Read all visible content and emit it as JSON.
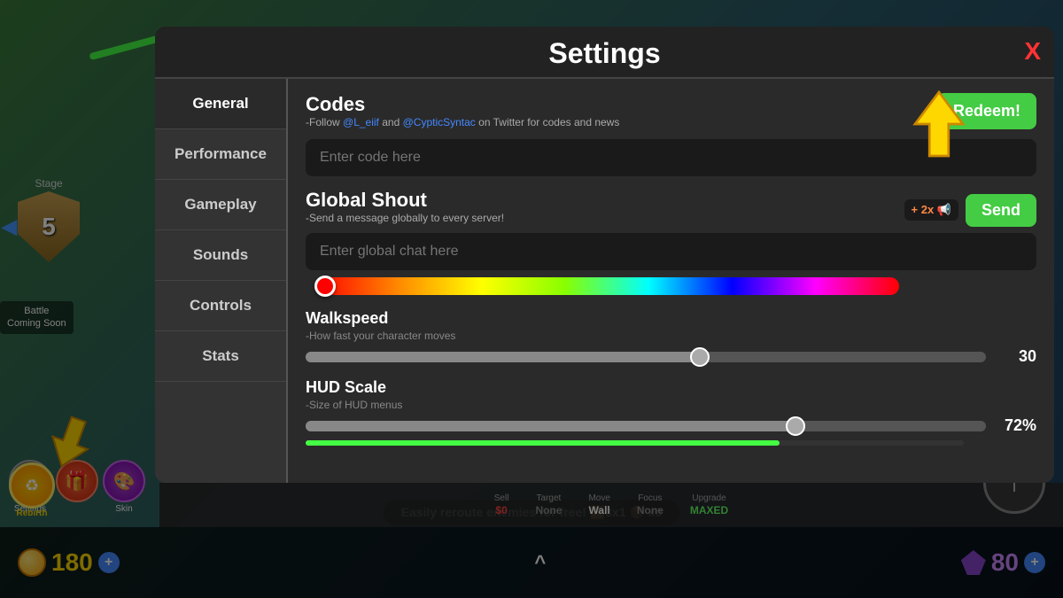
{
  "game": {
    "stage_label": "Stage",
    "stage_number": "5",
    "battle_label": "Battle",
    "coming_soon": "Coming Soon",
    "coins": "180",
    "gems": "80",
    "hint_text": "Easily reroute enemies for free! 🔀3x1 📦 x0"
  },
  "bottom_bar": {
    "sell_label": "Sell",
    "sell_value": "$0",
    "target_label": "Target",
    "target_value": "None",
    "move_label": "Move",
    "move_value": "Wall",
    "focus_label": "Focus",
    "focus_value": "None",
    "upgrade_label": "Upgrade",
    "upgrade_value": "MAXED"
  },
  "buttons": {
    "settings_label": "Settings",
    "gift_label": "",
    "skin_label": "Skin",
    "rebirth_label": "Rebirth",
    "plus": "+",
    "up_arrow": "↑"
  },
  "modal": {
    "title": "Settings",
    "close": "X",
    "nav": {
      "items": [
        {
          "id": "general",
          "label": "General"
        },
        {
          "id": "performance",
          "label": "Performance"
        },
        {
          "id": "gameplay",
          "label": "Gameplay"
        },
        {
          "id": "sounds",
          "label": "Sounds"
        },
        {
          "id": "controls",
          "label": "Controls"
        },
        {
          "id": "stats",
          "label": "Stats"
        }
      ]
    },
    "content": {
      "codes": {
        "title": "Codes",
        "subtitle_pre": "-Follow ",
        "mention1": "@L_eiif",
        "subtitle_mid": " and ",
        "mention2": "@CypticSyntac",
        "subtitle_post": " on Twitter for codes and news",
        "placeholder": "Enter code here",
        "redeem_label": "Redeem!"
      },
      "global_shout": {
        "title": "Global Shout",
        "subtitle": "-Send a message globally to every server!",
        "boost": "+ 2x 📢",
        "placeholder": "Enter global chat here",
        "send_label": "Send"
      },
      "walkspeed": {
        "title": "Walkspeed",
        "desc": "-How fast your character moves",
        "value": "30",
        "fill_pct": 58
      },
      "hud_scale": {
        "title": "HUD Scale",
        "desc": "-Size of HUD menus",
        "value": "72%",
        "fill_pct": 72
      }
    }
  }
}
